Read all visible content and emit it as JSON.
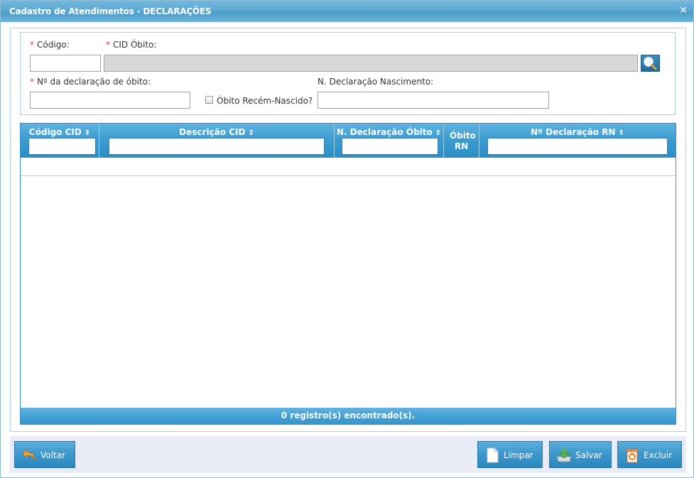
{
  "window": {
    "title": "Cadastro de Atendimentos - DECLARAÇÕES",
    "close_icon": "close-icon"
  },
  "form": {
    "codigo": {
      "label": "Código:",
      "required_mark": "*",
      "value": ""
    },
    "cid_obito": {
      "label": "CID Óbito:",
      "required_mark": "*",
      "value": ""
    },
    "num_declaracao_obito": {
      "label": "Nº da declaração de óbito:",
      "required_mark": "*",
      "value": ""
    },
    "obito_recem_nascido": {
      "label": "Óbito Recém-Nascido?",
      "checked": false
    },
    "n_declaracao_nascimento": {
      "label": "N. Declaração Nascimento:",
      "value": ""
    },
    "search_icon": "search-icon"
  },
  "grid": {
    "columns": [
      {
        "label": "Código CID",
        "sort": "⇕"
      },
      {
        "label": "Descrição CID",
        "sort": "⇕"
      },
      {
        "label": "N. Declaração Óbito",
        "sort": "⇕"
      },
      {
        "label": "Óbito RN",
        "sort": ""
      },
      {
        "label": "Nº Declaração RN",
        "sort": "⇕"
      }
    ],
    "rows": [],
    "footer": "0 registro(s) encontrado(s)."
  },
  "buttons": {
    "voltar": "Voltar",
    "limpar": "Limpar",
    "salvar": "Salvar",
    "excluir": "Excluir"
  }
}
